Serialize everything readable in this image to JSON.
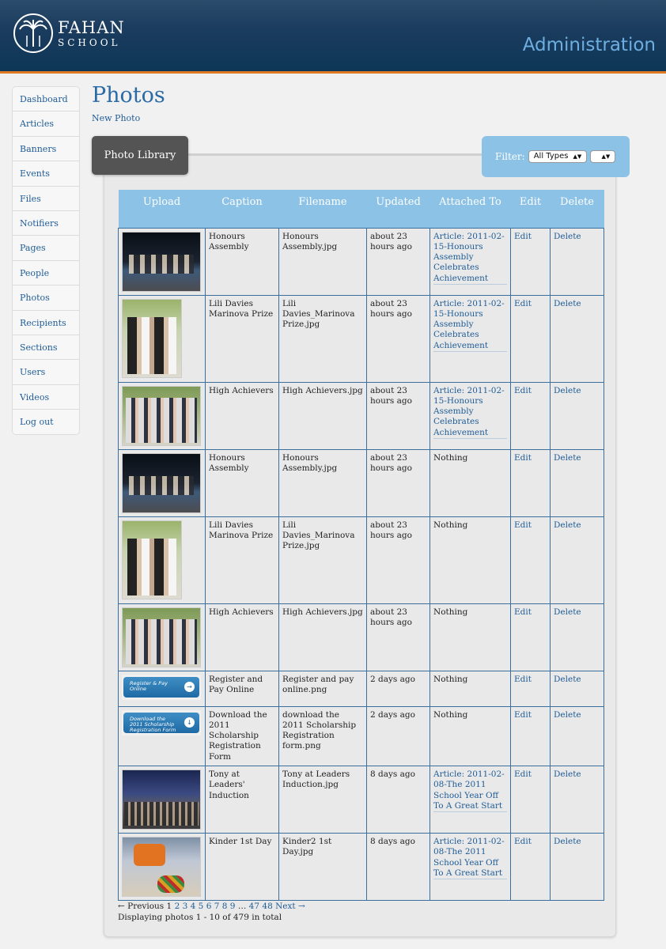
{
  "header": {
    "logo_line1": "FAHAN",
    "logo_line2": "SCHOOL",
    "title": "Administration"
  },
  "sidebar": {
    "items": [
      {
        "label": "Dashboard"
      },
      {
        "label": "Articles"
      },
      {
        "label": "Banners"
      },
      {
        "label": "Events"
      },
      {
        "label": "Files"
      },
      {
        "label": "Notifiers"
      },
      {
        "label": "Pages"
      },
      {
        "label": "People"
      },
      {
        "label": "Photos"
      },
      {
        "label": "Recipients"
      },
      {
        "label": "Sections"
      },
      {
        "label": "Users"
      },
      {
        "label": "Videos"
      },
      {
        "label": "Log out"
      }
    ]
  },
  "main": {
    "title": "Photos",
    "new_link": "New Photo",
    "tab_label": "Photo Library",
    "filter": {
      "label": "Filter:",
      "type_selected": "All Types",
      "second_selected": ""
    }
  },
  "table": {
    "headers": [
      "Upload",
      "Caption",
      "Filename",
      "Updated",
      "Attached To",
      "Edit",
      "Delete"
    ],
    "rows": [
      {
        "thumb": "stage",
        "caption": "Honours Assembly",
        "filename": "Honours Assembly.jpg",
        "updated": "about 23 hours ago",
        "attached": "Article: 2011-02-15-Honours Assembly Celebrates Achievement",
        "attached_is_link": true,
        "edit": "Edit",
        "delete": "Delete"
      },
      {
        "thumb": "portrait",
        "caption": "Lili Davies Marinova Prize",
        "filename": "Lili Davies_Marinova Prize.jpg",
        "updated": "about 23 hours ago",
        "attached": "Article: 2011-02-15-Honours Assembly Celebrates Achievement",
        "attached_is_link": true,
        "edit": "Edit",
        "delete": "Delete"
      },
      {
        "thumb": "group",
        "caption": "High Achievers",
        "filename": "High Achievers.jpg",
        "updated": "about 23 hours ago",
        "attached": "Article: 2011-02-15-Honours Assembly Celebrates Achievement",
        "attached_is_link": true,
        "edit": "Edit",
        "delete": "Delete"
      },
      {
        "thumb": "stage",
        "caption": "Honours Assembly",
        "filename": "Honours Assembly.jpg",
        "updated": "about 23 hours ago",
        "attached": "Nothing",
        "attached_is_link": false,
        "edit": "Edit",
        "delete": "Delete"
      },
      {
        "thumb": "portrait",
        "caption": "Lili Davies Marinova Prize",
        "filename": "Lili Davies_Marinova Prize.jpg",
        "updated": "about 23 hours ago",
        "attached": "Nothing",
        "attached_is_link": false,
        "edit": "Edit",
        "delete": "Delete"
      },
      {
        "thumb": "group",
        "caption": "High Achievers",
        "filename": "High Achievers.jpg",
        "updated": "about 23 hours ago",
        "attached": "Nothing",
        "attached_is_link": false,
        "edit": "Edit",
        "delete": "Delete"
      },
      {
        "thumb": "banner",
        "banner_text": "Register & Pay Online",
        "banner_icon": "→",
        "caption": "Register and Pay Online",
        "filename": "Register and pay online.png",
        "updated": "2 days ago",
        "attached": "Nothing",
        "attached_is_link": false,
        "edit": "Edit",
        "delete": "Delete"
      },
      {
        "thumb": "banner",
        "banner_text": "Download the 2011 Scholarship Registration Form",
        "banner_icon": "↓",
        "caption": "Download the 2011 Scholarship Registration Form",
        "filename": "download the 2011 Scholarship Registration form.png",
        "updated": "2 days ago",
        "attached": "Nothing",
        "attached_is_link": false,
        "edit": "Edit",
        "delete": "Delete"
      },
      {
        "thumb": "hall",
        "caption": "Tony at Leaders' Induction",
        "filename": "Tony at Leaders Induction.jpg",
        "updated": "8 days ago",
        "attached": "Article: 2011-02-08-The 2011 School Year Off To A Great Start",
        "attached_is_link": true,
        "edit": "Edit",
        "delete": "Delete"
      },
      {
        "thumb": "kinder",
        "caption": "Kinder 1st Day",
        "filename": "Kinder2 1st Day.jpg",
        "updated": "8 days ago",
        "attached": "Article: 2011-02-08-The 2011 School Year Off To A Great Start",
        "attached_is_link": true,
        "edit": "Edit",
        "delete": "Delete"
      }
    ]
  },
  "pagination": {
    "prev": "← Previous",
    "current": "1",
    "pages": [
      "2",
      "3",
      "4",
      "5",
      "6",
      "7",
      "8",
      "9"
    ],
    "ellipsis": "…",
    "tail_pages": [
      "47",
      "48"
    ],
    "next": "Next →",
    "summary": "Displaying photos 1 - 10 of 479 in total"
  },
  "colors": {
    "header_bg": "#0d3657",
    "accent_orange": "#e07a22",
    "admin_title": "#6eaee0",
    "table_header": "#8bc2e6",
    "link": "#1f5c96"
  }
}
